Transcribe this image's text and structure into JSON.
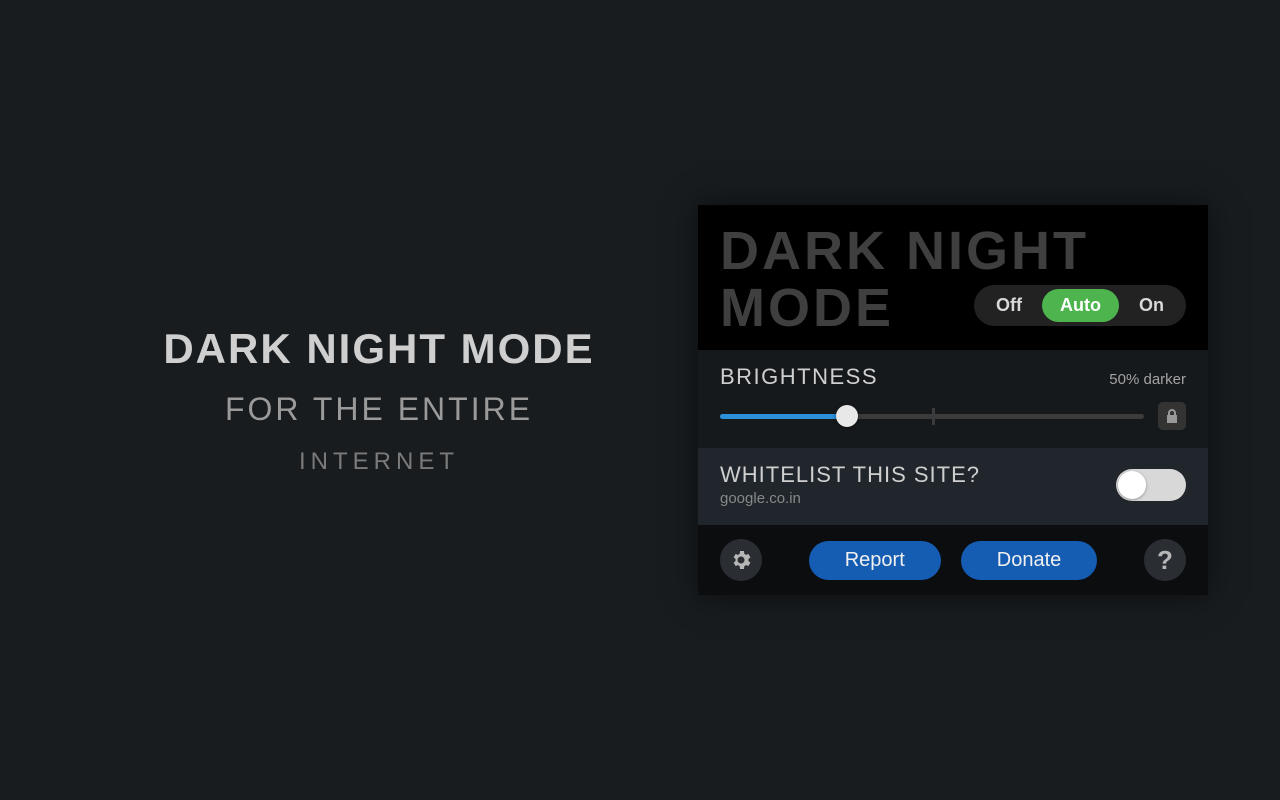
{
  "promo": {
    "headline": "DARK NIGHT MODE",
    "subhead1": "FOR THE ENTIRE",
    "subhead2": "INTERNET"
  },
  "popup": {
    "logo_line1": "DARK NIGHT",
    "logo_line2": "MODE",
    "mode": {
      "off": "Off",
      "auto": "Auto",
      "on": "On",
      "selected": "Auto"
    },
    "brightness": {
      "label": "BRIGHTNESS",
      "value_text": "50% darker",
      "slider_percent": 30
    },
    "whitelist": {
      "label": "WHITELIST THIS SITE?",
      "site": "google.co.in",
      "enabled": false
    },
    "footer": {
      "report": "Report",
      "donate": "Donate",
      "help": "?"
    }
  }
}
